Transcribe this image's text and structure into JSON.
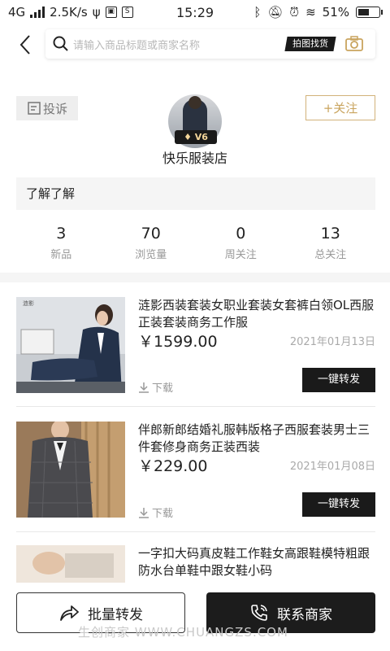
{
  "status_bar": {
    "network": "4G",
    "speed": "2.5K/s",
    "time": "15:29",
    "battery": "51%"
  },
  "search": {
    "placeholder": "请输入商品标题或商家名称",
    "photo_search_label": "拍图找货"
  },
  "store": {
    "complain_label": "投诉",
    "follow_label": "+关注",
    "level_badge": "V6",
    "name": "快乐服装店",
    "about": "了解了解"
  },
  "stats": [
    {
      "value": "3",
      "label": "新品"
    },
    {
      "value": "70",
      "label": "浏览量"
    },
    {
      "value": "0",
      "label": "周关注"
    },
    {
      "value": "13",
      "label": "总关注"
    }
  ],
  "products": [
    {
      "title": "涟影西装套装女职业套装女套裤白领OL西服正装套装商务工作服",
      "price": "￥1599.00",
      "date": "2021年01月13日",
      "download_label": "下载",
      "share_label": "一键转发"
    },
    {
      "title": "伴郎新郎结婚礼服韩版格子西服套装男士三件套修身商务正装西装",
      "price": "￥229.00",
      "date": "2021年01月08日",
      "download_label": "下载",
      "share_label": "一键转发"
    },
    {
      "title": "一字扣大码真皮鞋工作鞋女高跟鞋模特粗跟防水台单鞋中跟女鞋小码"
    }
  ],
  "bottom": {
    "batch_share_label": "批量转发",
    "contact_label": "联系商家"
  },
  "watermark": "生创商家 WWW.CHUANGZS.COM",
  "colors": {
    "accent_gold": "#c9a45e",
    "dark_button": "#1a1a1a"
  }
}
